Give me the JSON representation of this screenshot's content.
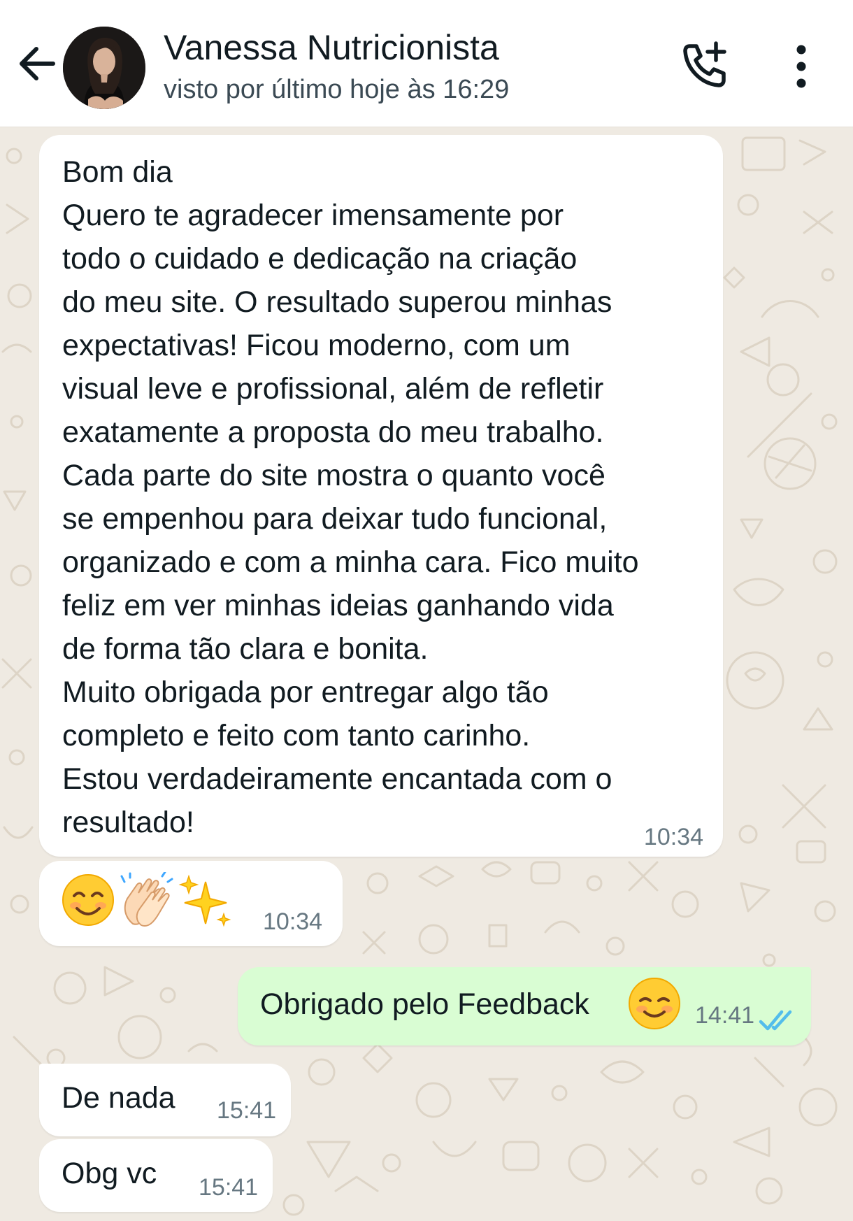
{
  "header": {
    "contact_name": "Vanessa Nutricionista",
    "status": "visto por último hoje às 16:29",
    "icons": {
      "back": "arrow-left-icon",
      "avatar": "avatar",
      "call": "phone-add-icon",
      "menu": "more-vertical-icon"
    }
  },
  "messages": [
    {
      "direction": "incoming",
      "lines": [
        "Bom dia",
        "Quero te agradecer imensamente por",
        "todo o cuidado e dedicação na criação",
        "do meu site. O resultado superou minhas",
        "expectativas! Ficou moderno, com um",
        "visual leve e profissional, além de refletir",
        "exatamente a proposta do meu trabalho.",
        "Cada parte do site mostra o quanto você",
        "se empenhou para deixar tudo funcional,",
        "organizado e com a minha cara. Fico muito",
        "feliz em ver minhas ideias ganhando vida",
        "de forma tão clara e bonita.",
        "Muito obrigada por entregar algo tão",
        "completo e feito com tanto carinho.",
        "Estou verdadeiramente encantada com o",
        "resultado!"
      ],
      "time": "10:34"
    },
    {
      "direction": "incoming",
      "emojis": [
        "smiling-face-emoji",
        "clapping-hands-emoji",
        "sparkles-emoji"
      ],
      "time": "10:34"
    },
    {
      "direction": "outgoing",
      "text": "Obrigado pelo Feedback",
      "emoji": "smiling-face-emoji",
      "time": "14:41",
      "status": "read"
    },
    {
      "direction": "incoming",
      "text": "De nada",
      "time": "15:41"
    },
    {
      "direction": "incoming",
      "text": "Obg vc",
      "time": "15:41"
    }
  ],
  "colors": {
    "chat_background": "#efeae2",
    "incoming_bubble": "#ffffff",
    "outgoing_bubble": "#d9fdd3",
    "read_ticks": "#53bdeb",
    "timestamp": "#667781"
  }
}
